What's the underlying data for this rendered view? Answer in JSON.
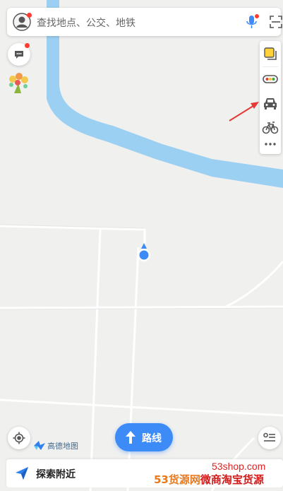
{
  "search": {
    "placeholder": "查找地点、公交、地铁",
    "avatar_icon": "user-avatar-icon",
    "mic_icon": "microphone-icon",
    "scan_icon": "scan-icon"
  },
  "left_controls": {
    "message_icon": "message-icon",
    "festival_icon": "bouquet-icon"
  },
  "right_toolbar": [
    {
      "name": "layers",
      "icon": "layers-icon"
    },
    {
      "name": "traffic",
      "icon": "traffic-light-icon"
    },
    {
      "name": "car",
      "icon": "car-icon"
    },
    {
      "name": "bike",
      "icon": "bicycle-icon"
    },
    {
      "name": "more",
      "icon": "more-icon"
    }
  ],
  "route_button": {
    "label": "路线",
    "icon": "route-arrow-icon"
  },
  "brand": {
    "name": "高德地图"
  },
  "bottom": {
    "label": "探索附近",
    "icon": "send-icon"
  },
  "watermark": {
    "url": "53shop.com",
    "part_a": "53货源网",
    "part_b": "微商淘宝货源"
  },
  "colors": {
    "map_background": "#f0f0ef",
    "river": "#9cd0f2",
    "road": "#ffffff",
    "accent": "#3d8bf7",
    "notification": "#ff3b30",
    "annotation_arrow": "#e53935"
  }
}
